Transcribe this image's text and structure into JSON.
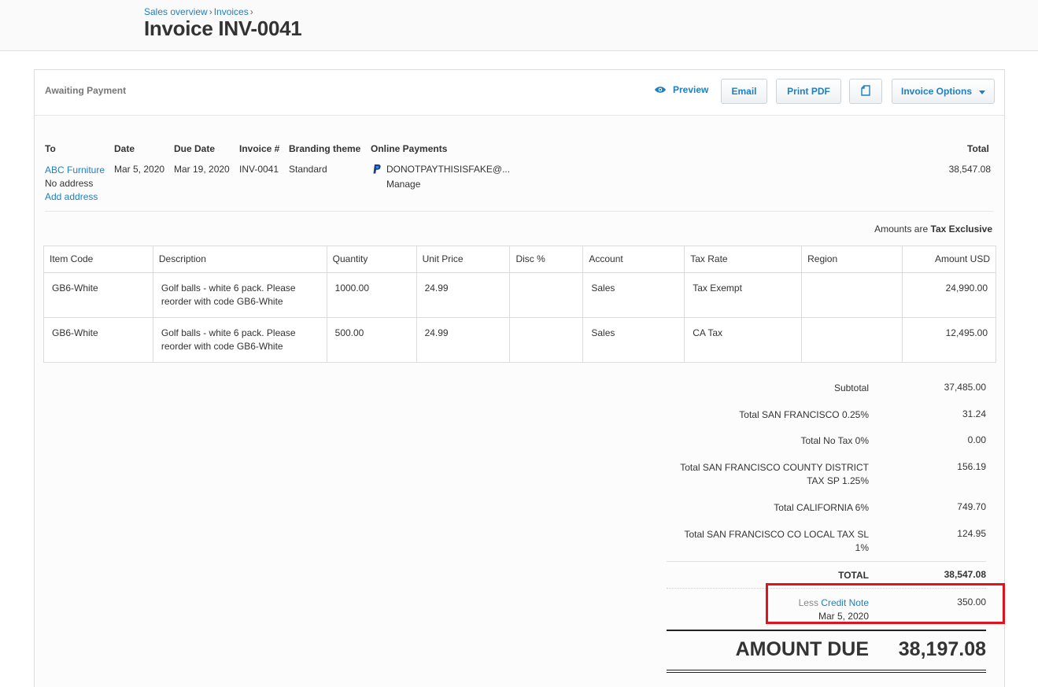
{
  "header": {
    "breadcrumb": [
      "Sales overview",
      "Invoices"
    ],
    "breadcrumb_sep": "›",
    "title": "Invoice INV-0041"
  },
  "toolbar": {
    "status": "Awaiting Payment",
    "preview_label": "Preview",
    "email_label": "Email",
    "print_label": "Print PDF",
    "options_label": "Invoice Options"
  },
  "info": {
    "labels": {
      "to": "To",
      "date": "Date",
      "due_date": "Due Date",
      "invoice_no": "Invoice #",
      "branding": "Branding theme",
      "online_payments": "Online Payments",
      "total": "Total"
    },
    "to_name": "ABC Furniture",
    "to_address": "No address",
    "add_address": "Add address",
    "date": "Mar 5, 2020",
    "due_date": "Mar 19, 2020",
    "invoice_no": "INV-0041",
    "branding": "Standard",
    "payment_account": "DONOTPAYTHISISFAKE@...",
    "manage": "Manage",
    "total": "38,547.08"
  },
  "tax_note": {
    "prefix": "Amounts are",
    "mode": "Tax Exclusive"
  },
  "table": {
    "columns": [
      "Item Code",
      "Description",
      "Quantity",
      "Unit Price",
      "Disc %",
      "Account",
      "Tax Rate",
      "Region",
      "Amount USD"
    ],
    "rows": [
      {
        "code": "GB6-White",
        "desc_1": "Golf balls - white 6 pack. Please",
        "desc_2": "reorder with code GB6-White",
        "qty": "1000.00",
        "price": "24.99",
        "disc": "",
        "account": "Sales",
        "tax": "Tax Exempt",
        "region": "",
        "amount": "24,990.00"
      },
      {
        "code": "GB6-White",
        "desc_1": "Golf balls - white 6 pack. Please",
        "desc_2": "reorder with code GB6-White",
        "qty": "500.00",
        "price": "24.99",
        "disc": "",
        "account": "Sales",
        "tax": "CA Tax",
        "region": "",
        "amount": "12,495.00"
      }
    ]
  },
  "totals": {
    "subtotal_label": "Subtotal",
    "subtotal": "37,485.00",
    "sf_label": "Total SAN FRANCISCO 0.25%",
    "sf": "31.24",
    "notax_label": "Total No Tax 0%",
    "notax": "0.00",
    "sfcd_label_1": "Total SAN FRANCISCO COUNTY DISTRICT",
    "sfcd_label_2": "TAX SP 1.25%",
    "sfcd": "156.19",
    "ca_label": "Total CALIFORNIA 6%",
    "ca": "749.70",
    "sfl_label_1": "Total SAN FRANCISCO CO LOCAL TAX SL",
    "sfl_label_2": "1%",
    "sfl": "124.95",
    "total_label": "TOTAL",
    "total": "38,547.08",
    "credit_less": "Less",
    "credit_link": "Credit Note",
    "credit_date": "Mar 5, 2020",
    "credit_amount": "350.00",
    "amount_due_label": "AMOUNT DUE",
    "amount_due": "38,197.08"
  },
  "colors": {
    "link": "#1f7fbf",
    "highlight": "#e0141e"
  }
}
